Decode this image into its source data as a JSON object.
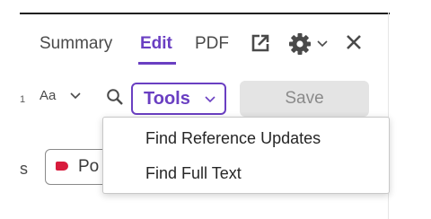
{
  "tabs": {
    "summary": "Summary",
    "edit": "Edit",
    "pdf": "PDF"
  },
  "icons": {
    "open_external": "external-link-icon",
    "settings": "gear-icon",
    "settings_menu": "chevron-down-icon",
    "close": "close-icon",
    "search": "search-icon"
  },
  "toolbar": {
    "partial_text": "1",
    "font_label": "Aa",
    "tools_label": "Tools",
    "save_label": "Save"
  },
  "tags": {
    "partial_label": "s",
    "chip_label": "Po"
  },
  "tools_menu": {
    "items": [
      "Find Reference Updates",
      "Find Full Text"
    ]
  },
  "colors": {
    "accent": "#6a3fc2",
    "tag_red": "#d81b3c",
    "save_disabled_bg": "#e4e4e4"
  }
}
